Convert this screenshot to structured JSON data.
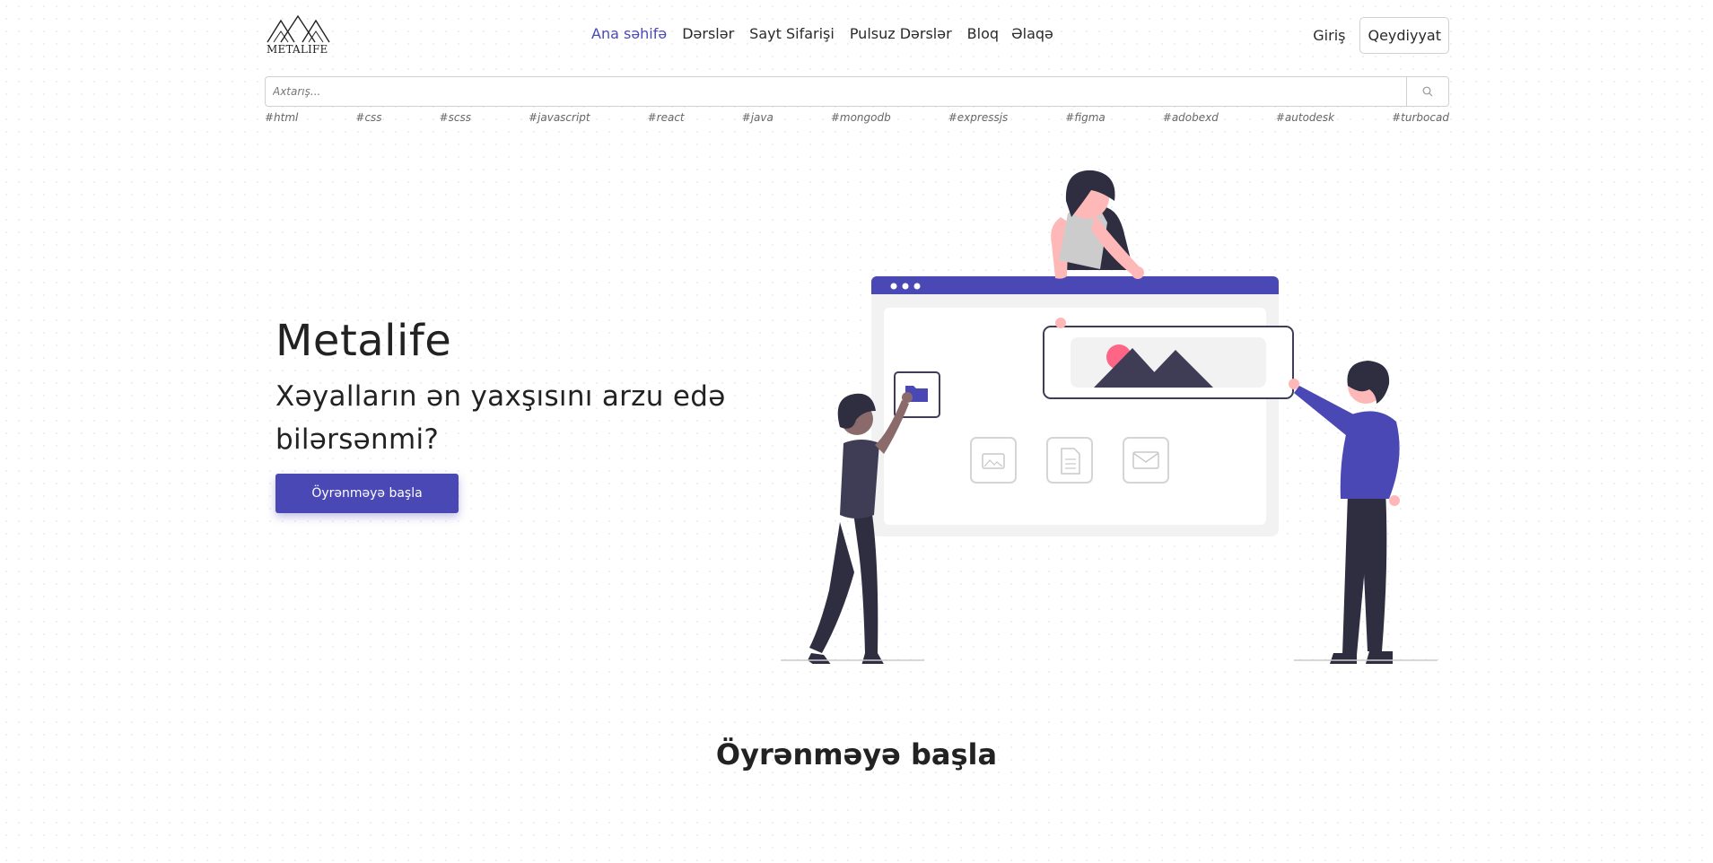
{
  "brand": {
    "logo_text": "METALIFE"
  },
  "nav": {
    "items": [
      {
        "label": "Ana səhifə",
        "active": true
      },
      {
        "label": "Dərslər",
        "active": false
      },
      {
        "label": "Sayt Sifarişi",
        "active": false
      },
      {
        "label": "Pulsuz Dərslər",
        "active": false
      },
      {
        "label": "Bloq",
        "active": false
      },
      {
        "label": "Əlaqə",
        "active": false
      }
    ]
  },
  "auth": {
    "login_label": "Giriş",
    "register_label": "Qeydiyyat"
  },
  "search": {
    "placeholder": "Axtarış...",
    "value": ""
  },
  "tags": [
    "#html",
    "#css",
    "#scss",
    "#javascript",
    "#react",
    "#java",
    "#mongodb",
    "#expressjs",
    "#figma",
    "#adobexd",
    "#autodesk",
    "#turbocad"
  ],
  "hero": {
    "title": "Metalife",
    "subtitle": "Xəyalların ən yaxşısını arzu edə bilərsənmi?",
    "cta_label": "Öyrənməyə başla"
  },
  "section": {
    "title": "Öyrənməyə başla"
  },
  "colors": {
    "accent": "#4a48b5",
    "pink": "#ffb8b8",
    "dark": "#2f2e41",
    "highlight": "#ff6584"
  },
  "icons": [
    "search-icon",
    "folder-icon",
    "image-icon",
    "document-icon",
    "mail-icon"
  ]
}
